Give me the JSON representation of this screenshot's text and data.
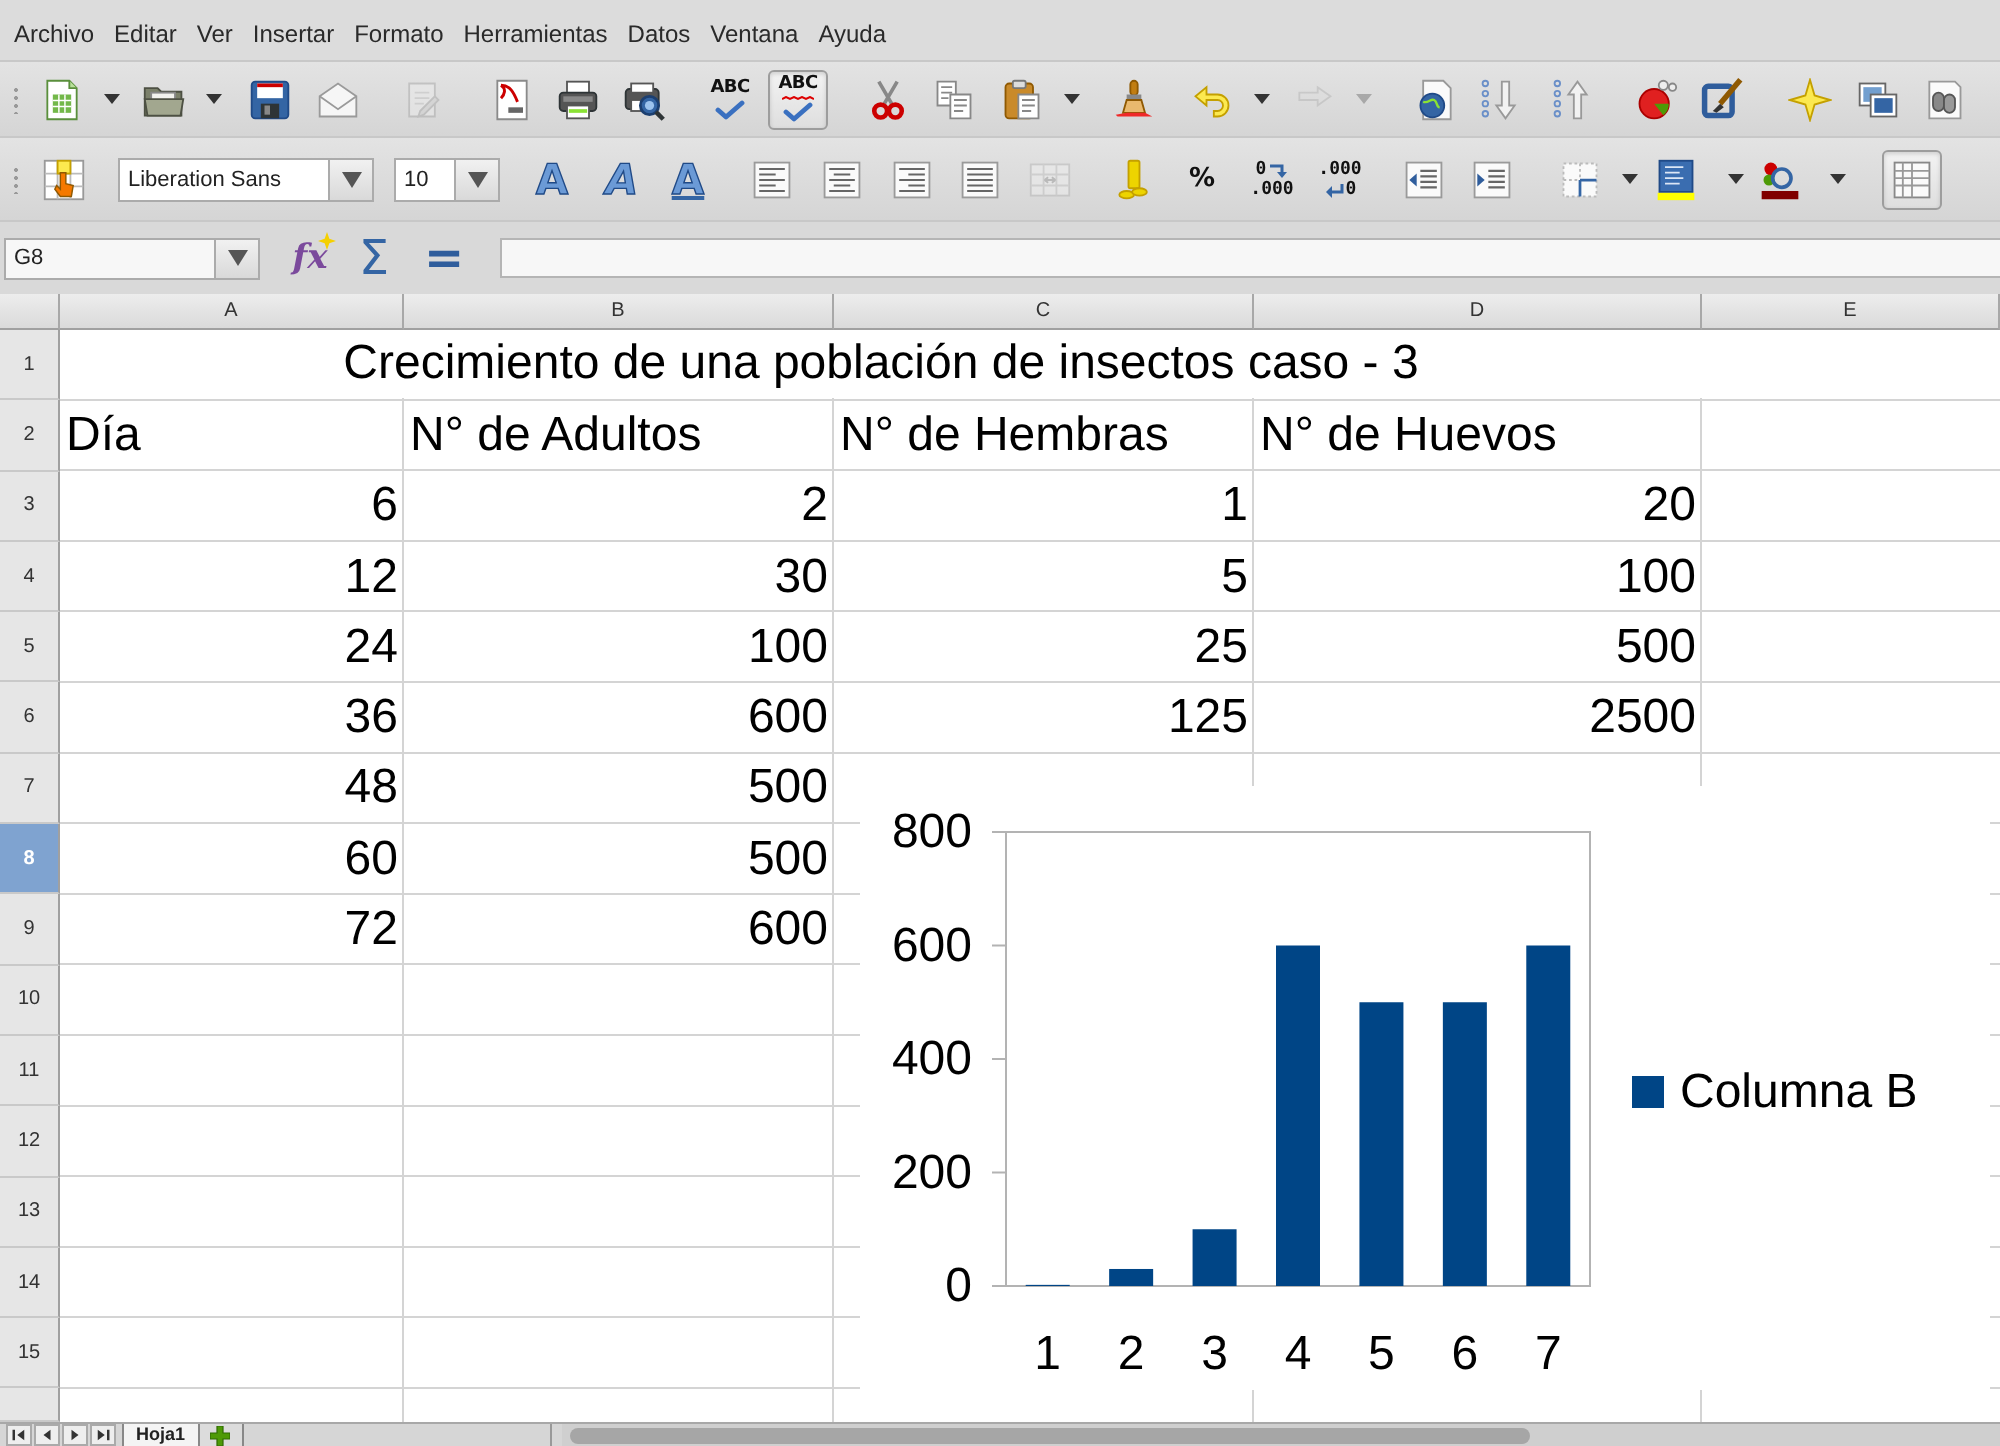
{
  "menu_bar": [
    "Archivo",
    "Editar",
    "Ver",
    "Insertar",
    "Formato",
    "Herramientas",
    "Datos",
    "Ventana",
    "Ayuda"
  ],
  "standard_toolbar": [
    {
      "disabled": false,
      "menu": true
    },
    {
      "disabled": false,
      "menu": true
    },
    {
      "disabled": false
    },
    {
      "disabled": false
    },
    {
      "disabled": true
    },
    {
      "disabled": false
    },
    {
      "disabled": false
    },
    {
      "disabled": false
    },
    {
      "label": "ABC",
      "disabled": false
    },
    {
      "label": "ABC",
      "pressed": true,
      "disabled": false
    },
    {
      "disabled": false
    },
    {
      "disabled": false
    },
    {
      "disabled": false,
      "menu": true
    },
    {
      "disabled": false
    },
    {
      "disabled": false,
      "menu": true
    },
    {
      "disabled": true,
      "menu": true
    },
    {
      "disabled": false
    },
    {
      "disabled": false
    },
    {
      "disabled": false
    },
    {
      "disabled": false
    },
    {
      "disabled": false
    },
    {
      "disabled": false
    },
    {
      "disabled": false
    },
    {
      "disabled": false
    }
  ],
  "formatting_toolbar": {
    "font_name": "Liberation Sans",
    "font_size": "10",
    "buttons": [
      {
        "label": "A",
        "pressed": false,
        "disabled": false
      },
      {
        "label": "A",
        "pressed": false,
        "disabled": false
      },
      {
        "label": "A",
        "pressed": false,
        "disabled": false
      },
      {
        "pressed": false,
        "disabled": false
      },
      {
        "pressed": false,
        "disabled": false
      },
      {
        "pressed": false,
        "disabled": false
      },
      {
        "pressed": false,
        "disabled": false
      },
      {
        "pressed": false,
        "disabled": true
      },
      {
        "pressed": false,
        "disabled": false
      },
      {
        "label": "%",
        "pressed": false,
        "disabled": false
      },
      {
        "lines": [
          "0",
          ".000"
        ],
        "pressed": false,
        "disabled": false
      },
      {
        "lines": [
          ".000",
          "0"
        ],
        "pressed": false,
        "disabled": false
      },
      {
        "pressed": false,
        "disabled": false
      },
      {
        "pressed": false,
        "disabled": false
      },
      {
        "pressed": false,
        "disabled": false,
        "menu": true
      },
      {
        "pressed": false,
        "disabled": false,
        "menu": true
      },
      {
        "pressed": false,
        "disabled": false,
        "menu": true
      },
      {
        "pressed": true,
        "disabled": false
      }
    ]
  },
  "formula_bar": {
    "name_box": "G8",
    "buttons": [
      "fx",
      "Σ",
      "="
    ]
  },
  "sheet": {
    "columns": [
      "A",
      "B",
      "C",
      "D",
      "E"
    ],
    "rows": [
      {
        "label": "1",
        "selected": false
      },
      {
        "label": "2",
        "selected": false
      },
      {
        "label": "3",
        "selected": false
      },
      {
        "label": "4",
        "selected": false
      },
      {
        "label": "5",
        "selected": false
      },
      {
        "label": "6",
        "selected": false
      },
      {
        "label": "7",
        "selected": false
      },
      {
        "label": "8",
        "selected": true
      },
      {
        "label": "9",
        "selected": false
      },
      {
        "label": "10",
        "selected": false
      },
      {
        "label": "11",
        "selected": false
      },
      {
        "label": "12",
        "selected": false
      },
      {
        "label": "13",
        "selected": false
      },
      {
        "label": "14",
        "selected": false
      },
      {
        "label": "15",
        "selected": false
      }
    ],
    "title": "Crecimiento de una población de insectos caso - 3",
    "headers": [
      "Día",
      "N° de Adultos",
      "N° de Hembras",
      "N° de Huevos"
    ],
    "data": [
      [
        "6",
        "2",
        "1",
        "20"
      ],
      [
        "12",
        "30",
        "5",
        "100"
      ],
      [
        "24",
        "100",
        "25",
        "500"
      ],
      [
        "36",
        "600",
        "125",
        "2500"
      ],
      [
        "48",
        "500"
      ],
      [
        "60",
        "500"
      ],
      [
        "72",
        "600"
      ]
    ]
  },
  "chart": {
    "chart_data": {
      "type": "bar",
      "categories": [
        "1",
        "2",
        "3",
        "4",
        "5",
        "6",
        "7"
      ],
      "series": [
        {
          "name": "Columna B",
          "color": "#004586",
          "values": [
            2,
            30,
            100,
            600,
            500,
            500,
            600
          ]
        }
      ],
      "ylim": [
        0,
        800
      ],
      "yticks": [
        0,
        200,
        400,
        600,
        800
      ]
    }
  },
  "sheet_tabs": [
    {
      "label": "Hoja1",
      "selected": true
    }
  ]
}
